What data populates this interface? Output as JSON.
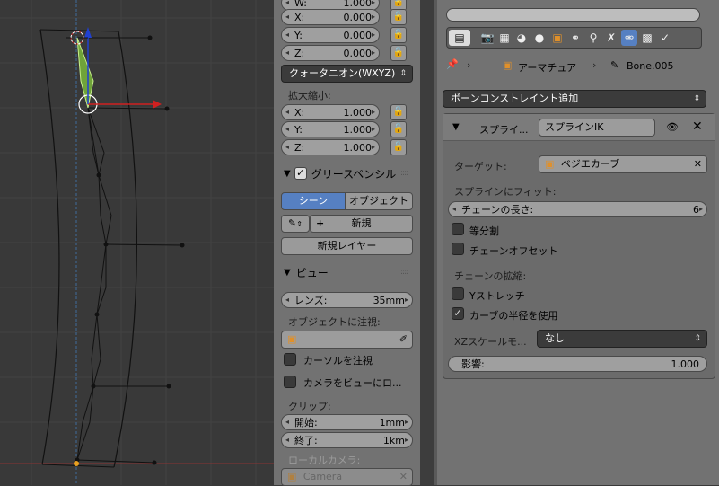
{
  "npanel": {
    "w_label": "W:",
    "w_value": "1.000",
    "x_label": "X:",
    "x_value": "0.000",
    "y_label": "Y:",
    "y_value": "0.000",
    "z_label": "Z:",
    "z_value": "0.000",
    "rotation_mode": "クォータニオン(WXYZ)",
    "scale_header": "拡大縮小:",
    "sx_label": "X:",
    "sx_value": "1.000",
    "sy_label": "Y:",
    "sy_value": "1.000",
    "sz_label": "Z:",
    "sz_value": "1.000",
    "grease_header": "グリースペンシル",
    "scene_btn": "シーン",
    "object_btn": "オブジェクト",
    "new_btn": "新規",
    "new_layer_btn": "新規レイヤー",
    "view_header": "ビュー",
    "lens_label": "レンズ:",
    "lens_value": "35mm",
    "lock_object_label": "オブジェクトに注視:",
    "lock_cursor_label": "カーソルを注視",
    "lock_camera_label": "カメラをビューにロ...",
    "clip_label": "クリップ:",
    "clip_start_label": "開始:",
    "clip_start_value": "1mm",
    "clip_end_label": "終了:",
    "clip_end_value": "1km",
    "local_camera_label": "ローカルカメラ:",
    "local_camera_value": "Camera"
  },
  "props": {
    "breadcrumb_armature": "アーマチュア",
    "breadcrumb_bone": "Bone.005",
    "add_constraint": "ボーンコンストレイント追加",
    "constraint_type": "スプライ...",
    "constraint_name": "スプラインIK",
    "target_label": "ターゲット:",
    "target_value": "ベジエカーブ",
    "fitting_label": "スプラインにフィット:",
    "chain_label": "チェーンの長さ:",
    "chain_value": "6",
    "even_div_label": "等分割",
    "chain_offset_label": "チェーンオフセット",
    "chain_scaling_label": "チェーンの拡縮:",
    "y_stretch_label": "Yストレッチ",
    "curve_radius_label": "カーブの半径を使用",
    "curve_radius_checked": true,
    "xz_mode_label": "XZスケールモ...",
    "xz_mode_value": "なし",
    "influence_label": "影響:",
    "influence_value": "1.000"
  },
  "colors": {
    "accent_blue": "#5680c2",
    "panel_bg": "#727272",
    "viewport_bg": "#393939"
  }
}
